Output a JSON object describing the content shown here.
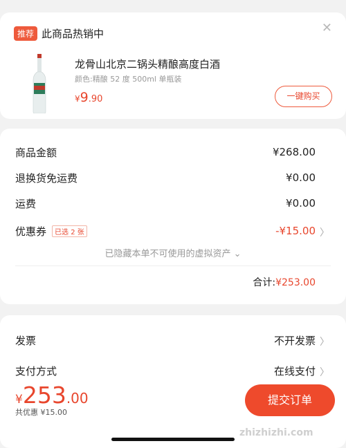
{
  "recommend": {
    "tag": "推荐",
    "title": "此商品热销中",
    "product_name": "龙骨山北京二锅头精酿高度白酒",
    "product_spec": "颜色:精酿 52 度 500ml 单瓶装",
    "price_symbol": "¥",
    "price_int": "9",
    "price_dec": ".90",
    "buy_label": "一键购买"
  },
  "amounts": {
    "goods_label": "商品金额",
    "goods_value": "¥268.00",
    "return_shipping_label": "退换货免运费",
    "return_shipping_value": "¥0.00",
    "shipping_label": "运费",
    "shipping_value": "¥0.00",
    "coupon_label": "优惠券",
    "coupon_tag": "已选 2 张",
    "coupon_value": "-¥15.00",
    "hidden_note": "已隐藏本单不可使用的虚拟资产 ⌄",
    "total_label": "合计:",
    "total_value": "¥253.00"
  },
  "payment": {
    "invoice_label": "发票",
    "invoice_value": "不开发票",
    "pay_method_label": "支付方式",
    "pay_method_value": "在线支付"
  },
  "bottom": {
    "price_symbol": "¥",
    "price_int": "253",
    "price_dec": ".00",
    "saved": "共优惠 ¥15.00",
    "submit_label": "提交订单"
  },
  "watermark": "zhizhizhi.com",
  "colors": {
    "accent": "#ee4a2c",
    "price": "#e8462d"
  }
}
